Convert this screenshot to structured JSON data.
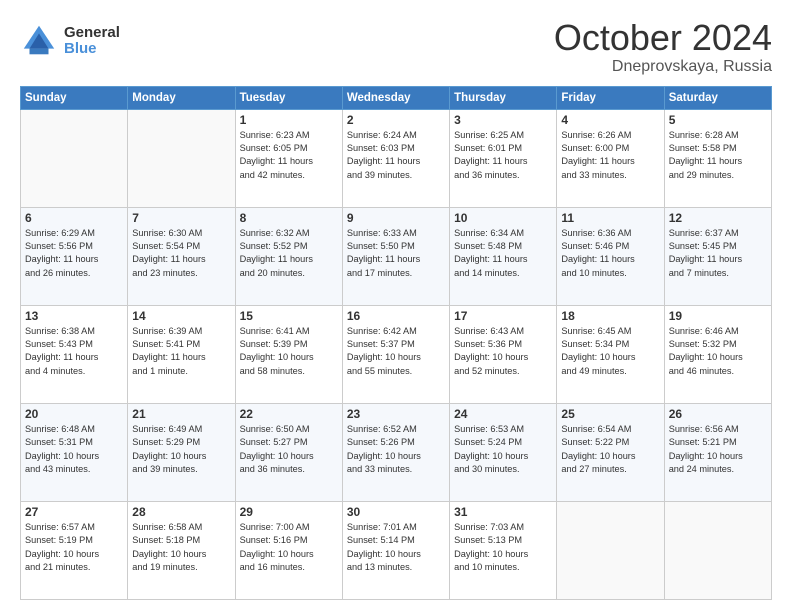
{
  "header": {
    "logo": {
      "general": "General",
      "blue": "Blue"
    },
    "title": "October 2024",
    "location": "Dneprovskaya, Russia"
  },
  "calendar": {
    "days_of_week": [
      "Sunday",
      "Monday",
      "Tuesday",
      "Wednesday",
      "Thursday",
      "Friday",
      "Saturday"
    ],
    "weeks": [
      [
        {
          "day": "",
          "content": ""
        },
        {
          "day": "",
          "content": ""
        },
        {
          "day": "1",
          "content": "Sunrise: 6:23 AM\nSunset: 6:05 PM\nDaylight: 11 hours\nand 42 minutes."
        },
        {
          "day": "2",
          "content": "Sunrise: 6:24 AM\nSunset: 6:03 PM\nDaylight: 11 hours\nand 39 minutes."
        },
        {
          "day": "3",
          "content": "Sunrise: 6:25 AM\nSunset: 6:01 PM\nDaylight: 11 hours\nand 36 minutes."
        },
        {
          "day": "4",
          "content": "Sunrise: 6:26 AM\nSunset: 6:00 PM\nDaylight: 11 hours\nand 33 minutes."
        },
        {
          "day": "5",
          "content": "Sunrise: 6:28 AM\nSunset: 5:58 PM\nDaylight: 11 hours\nand 29 minutes."
        }
      ],
      [
        {
          "day": "6",
          "content": "Sunrise: 6:29 AM\nSunset: 5:56 PM\nDaylight: 11 hours\nand 26 minutes."
        },
        {
          "day": "7",
          "content": "Sunrise: 6:30 AM\nSunset: 5:54 PM\nDaylight: 11 hours\nand 23 minutes."
        },
        {
          "day": "8",
          "content": "Sunrise: 6:32 AM\nSunset: 5:52 PM\nDaylight: 11 hours\nand 20 minutes."
        },
        {
          "day": "9",
          "content": "Sunrise: 6:33 AM\nSunset: 5:50 PM\nDaylight: 11 hours\nand 17 minutes."
        },
        {
          "day": "10",
          "content": "Sunrise: 6:34 AM\nSunset: 5:48 PM\nDaylight: 11 hours\nand 14 minutes."
        },
        {
          "day": "11",
          "content": "Sunrise: 6:36 AM\nSunset: 5:46 PM\nDaylight: 11 hours\nand 10 minutes."
        },
        {
          "day": "12",
          "content": "Sunrise: 6:37 AM\nSunset: 5:45 PM\nDaylight: 11 hours\nand 7 minutes."
        }
      ],
      [
        {
          "day": "13",
          "content": "Sunrise: 6:38 AM\nSunset: 5:43 PM\nDaylight: 11 hours\nand 4 minutes."
        },
        {
          "day": "14",
          "content": "Sunrise: 6:39 AM\nSunset: 5:41 PM\nDaylight: 11 hours\nand 1 minute."
        },
        {
          "day": "15",
          "content": "Sunrise: 6:41 AM\nSunset: 5:39 PM\nDaylight: 10 hours\nand 58 minutes."
        },
        {
          "day": "16",
          "content": "Sunrise: 6:42 AM\nSunset: 5:37 PM\nDaylight: 10 hours\nand 55 minutes."
        },
        {
          "day": "17",
          "content": "Sunrise: 6:43 AM\nSunset: 5:36 PM\nDaylight: 10 hours\nand 52 minutes."
        },
        {
          "day": "18",
          "content": "Sunrise: 6:45 AM\nSunset: 5:34 PM\nDaylight: 10 hours\nand 49 minutes."
        },
        {
          "day": "19",
          "content": "Sunrise: 6:46 AM\nSunset: 5:32 PM\nDaylight: 10 hours\nand 46 minutes."
        }
      ],
      [
        {
          "day": "20",
          "content": "Sunrise: 6:48 AM\nSunset: 5:31 PM\nDaylight: 10 hours\nand 43 minutes."
        },
        {
          "day": "21",
          "content": "Sunrise: 6:49 AM\nSunset: 5:29 PM\nDaylight: 10 hours\nand 39 minutes."
        },
        {
          "day": "22",
          "content": "Sunrise: 6:50 AM\nSunset: 5:27 PM\nDaylight: 10 hours\nand 36 minutes."
        },
        {
          "day": "23",
          "content": "Sunrise: 6:52 AM\nSunset: 5:26 PM\nDaylight: 10 hours\nand 33 minutes."
        },
        {
          "day": "24",
          "content": "Sunrise: 6:53 AM\nSunset: 5:24 PM\nDaylight: 10 hours\nand 30 minutes."
        },
        {
          "day": "25",
          "content": "Sunrise: 6:54 AM\nSunset: 5:22 PM\nDaylight: 10 hours\nand 27 minutes."
        },
        {
          "day": "26",
          "content": "Sunrise: 6:56 AM\nSunset: 5:21 PM\nDaylight: 10 hours\nand 24 minutes."
        }
      ],
      [
        {
          "day": "27",
          "content": "Sunrise: 6:57 AM\nSunset: 5:19 PM\nDaylight: 10 hours\nand 21 minutes."
        },
        {
          "day": "28",
          "content": "Sunrise: 6:58 AM\nSunset: 5:18 PM\nDaylight: 10 hours\nand 19 minutes."
        },
        {
          "day": "29",
          "content": "Sunrise: 7:00 AM\nSunset: 5:16 PM\nDaylight: 10 hours\nand 16 minutes."
        },
        {
          "day": "30",
          "content": "Sunrise: 7:01 AM\nSunset: 5:14 PM\nDaylight: 10 hours\nand 13 minutes."
        },
        {
          "day": "31",
          "content": "Sunrise: 7:03 AM\nSunset: 5:13 PM\nDaylight: 10 hours\nand 10 minutes."
        },
        {
          "day": "",
          "content": ""
        },
        {
          "day": "",
          "content": ""
        }
      ]
    ]
  }
}
